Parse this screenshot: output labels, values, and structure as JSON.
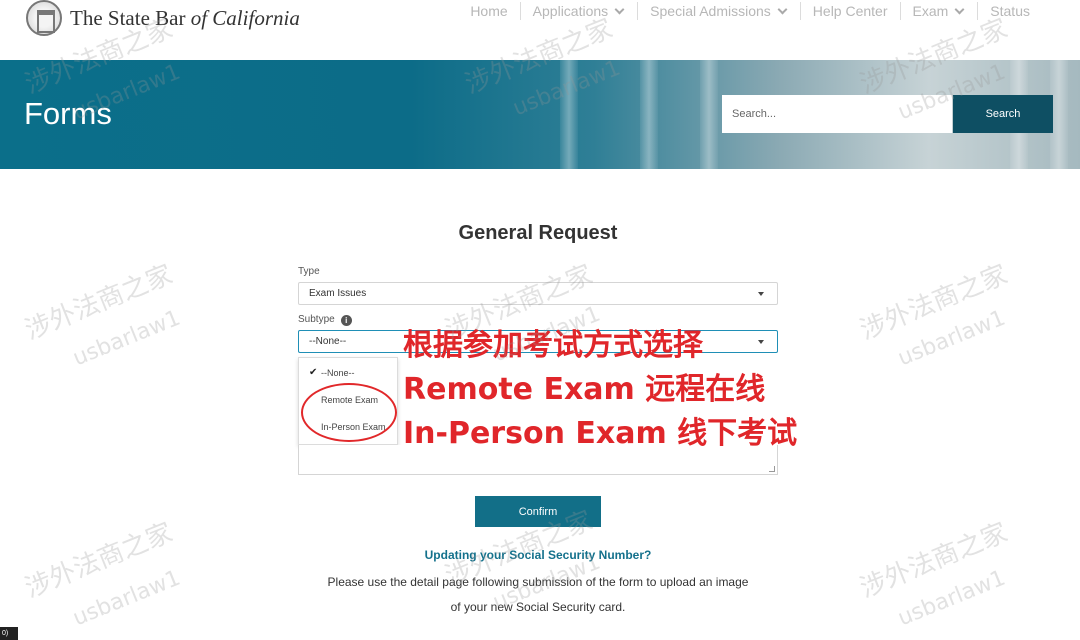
{
  "header": {
    "logo_text_plain": "The State Bar ",
    "logo_text_italic": "of California",
    "nav": [
      {
        "label": "Home",
        "has_dropdown": false
      },
      {
        "label": "Applications",
        "has_dropdown": true
      },
      {
        "label": "Special Admissions",
        "has_dropdown": true
      },
      {
        "label": "Help Center",
        "has_dropdown": false
      },
      {
        "label": "Exam",
        "has_dropdown": true
      },
      {
        "label": "Status",
        "has_dropdown": false
      }
    ]
  },
  "banner": {
    "title": "Forms",
    "search_placeholder": "Search...",
    "search_button": "Search"
  },
  "form": {
    "title": "General Request",
    "type_label": "Type",
    "type_value": "Exam Issues",
    "subtype_label": "Subtype",
    "subtype_value": "--None--",
    "subtype_options": [
      "--None--",
      "Remote Exam",
      "In-Person Exam"
    ],
    "selected_option": "--None--",
    "confirm_button": "Confirm",
    "ssn_link": "Updating your Social Security Number?",
    "ssn_text_line1": "Please use the detail page following submission of the form to upload an image",
    "ssn_text_line2": "of your new Social Security card."
  },
  "annotation": {
    "line1": "根据参加考试方式选择",
    "line2": "Remote Exam 远程在线",
    "line3": "In-Person Exam 线下考试",
    "color": "#e0262a"
  },
  "watermark": {
    "cn": "涉外法商之家",
    "en": "usbarlaw1"
  },
  "corner_tag": "0)",
  "colors": {
    "banner_teal": "#0b6f8a",
    "search_button": "#0e4f63",
    "confirm_button": "#126f88",
    "link": "#14718c"
  }
}
